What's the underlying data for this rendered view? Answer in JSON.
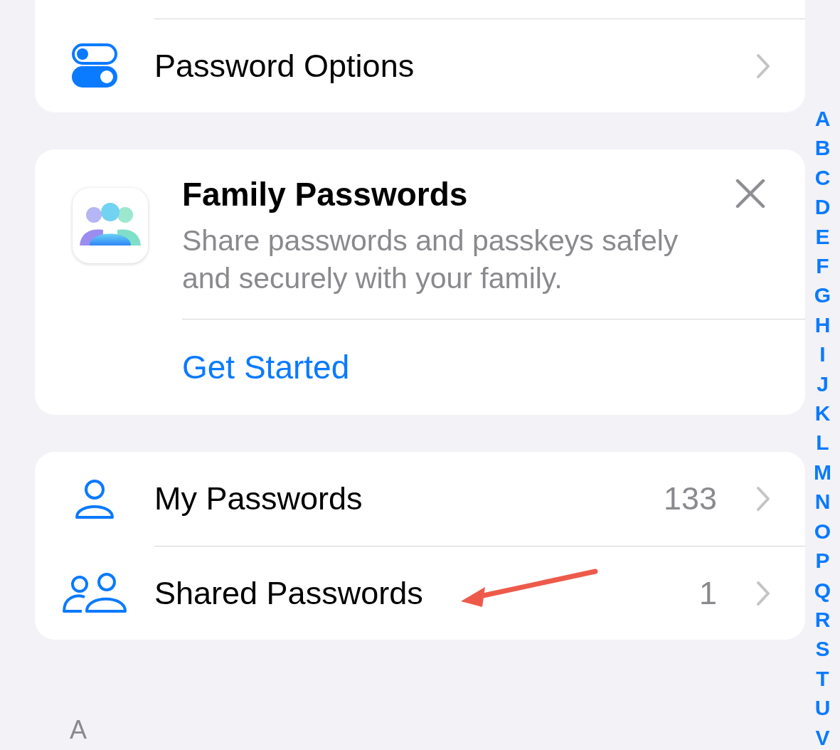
{
  "password_options": {
    "label": "Password Options"
  },
  "family_card": {
    "title": "Family Passwords",
    "description": "Share passwords and passkeys safely and securely with your family.",
    "action": "Get Started"
  },
  "password_groups": [
    {
      "kind": "person",
      "label": "My Passwords",
      "count": "133"
    },
    {
      "kind": "people",
      "label": "Shared Passwords",
      "count": "1"
    }
  ],
  "section_header": "A",
  "index_letters": [
    "A",
    "B",
    "C",
    "D",
    "E",
    "F",
    "G",
    "H",
    "I",
    "J",
    "K",
    "L",
    "M",
    "N",
    "O",
    "P",
    "Q",
    "R",
    "S",
    "T",
    "U",
    "V"
  ]
}
